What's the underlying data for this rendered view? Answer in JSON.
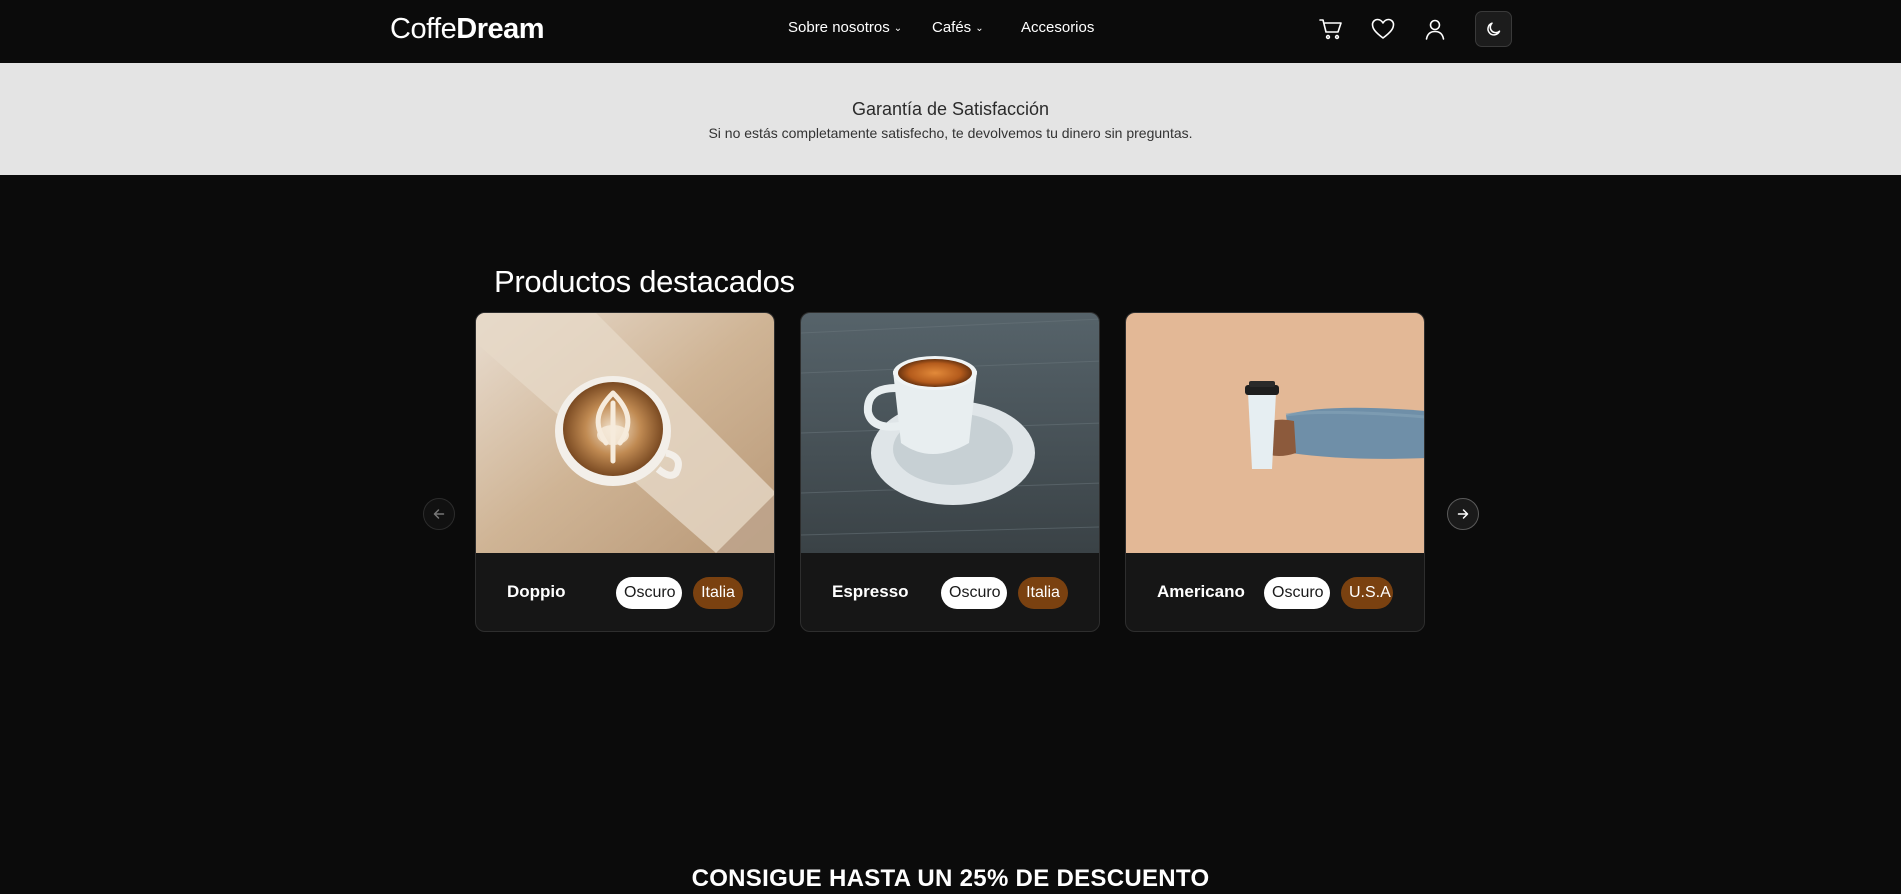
{
  "nav": {
    "logo_light": "Coffe",
    "logo_bold": "Dream",
    "links": [
      {
        "label": "Sobre nosotros",
        "has_dropdown": true
      },
      {
        "label": "Cafés",
        "has_dropdown": true
      },
      {
        "label": "Accesorios",
        "has_dropdown": false
      }
    ],
    "icons": [
      "cart-icon",
      "heart-icon",
      "user-icon",
      "moon-icon"
    ]
  },
  "banner": {
    "title": "Garantía de Satisfacción",
    "subtitle": "Si no estás completamente satisfecho, te devolvemos tu dinero sin preguntas."
  },
  "featured": {
    "title": "Productos destacados",
    "products": [
      {
        "name": "Doppio",
        "roast": "Oscuro",
        "origin": "Italia",
        "image": "latte-art-cup"
      },
      {
        "name": "Espresso",
        "roast": "Oscuro",
        "origin": "Italia",
        "image": "espresso-cup-saucer"
      },
      {
        "name": "Americano",
        "roast": "Oscuro",
        "origin": "U.S.A",
        "image": "takeaway-cup-hand"
      }
    ]
  },
  "promo": {
    "text": "CONSIGUE HASTA UN 25% DE DESCUENTO"
  },
  "colors": {
    "background": "#0b0b0b",
    "banner": "#e4e4e4",
    "card": "#161616",
    "tag_brown": "#7a4110"
  }
}
